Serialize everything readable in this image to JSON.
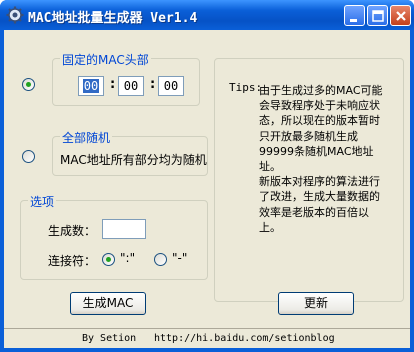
{
  "window": {
    "title": "MAC地址批量生成器 Ver1.4",
    "icon": "gear-icon"
  },
  "fixed_header": {
    "title": "固定的MAC头部",
    "selected": true,
    "octets": [
      "00",
      "00",
      "00"
    ],
    "separator": ":"
  },
  "random": {
    "title": "全部随机",
    "selected": false,
    "description": "MAC地址所有部分均为随机"
  },
  "options": {
    "title": "选项",
    "count_label": "生成数：",
    "count_value": "",
    "connector_label": "连接符：",
    "connector_options": [
      {
        "label": "\":\"",
        "selected": true
      },
      {
        "label": "\"-\"",
        "selected": false
      }
    ]
  },
  "tips": {
    "label": "Tips:",
    "paragraphs": [
      "由于生成过多的MAC可能会导致程序处于未响应状态，所以现在的版本暂时只开放最多随机生成99999条随机MAC地址址。",
      "新版本对程序的算法进行了改进，生成大量数据的效率是老版本的百倍以上。"
    ]
  },
  "buttons": {
    "generate": "生成MAC",
    "update": "更新"
  },
  "status": {
    "by": "By Setion",
    "url": "http://hi.baidu.com/setionblog"
  }
}
